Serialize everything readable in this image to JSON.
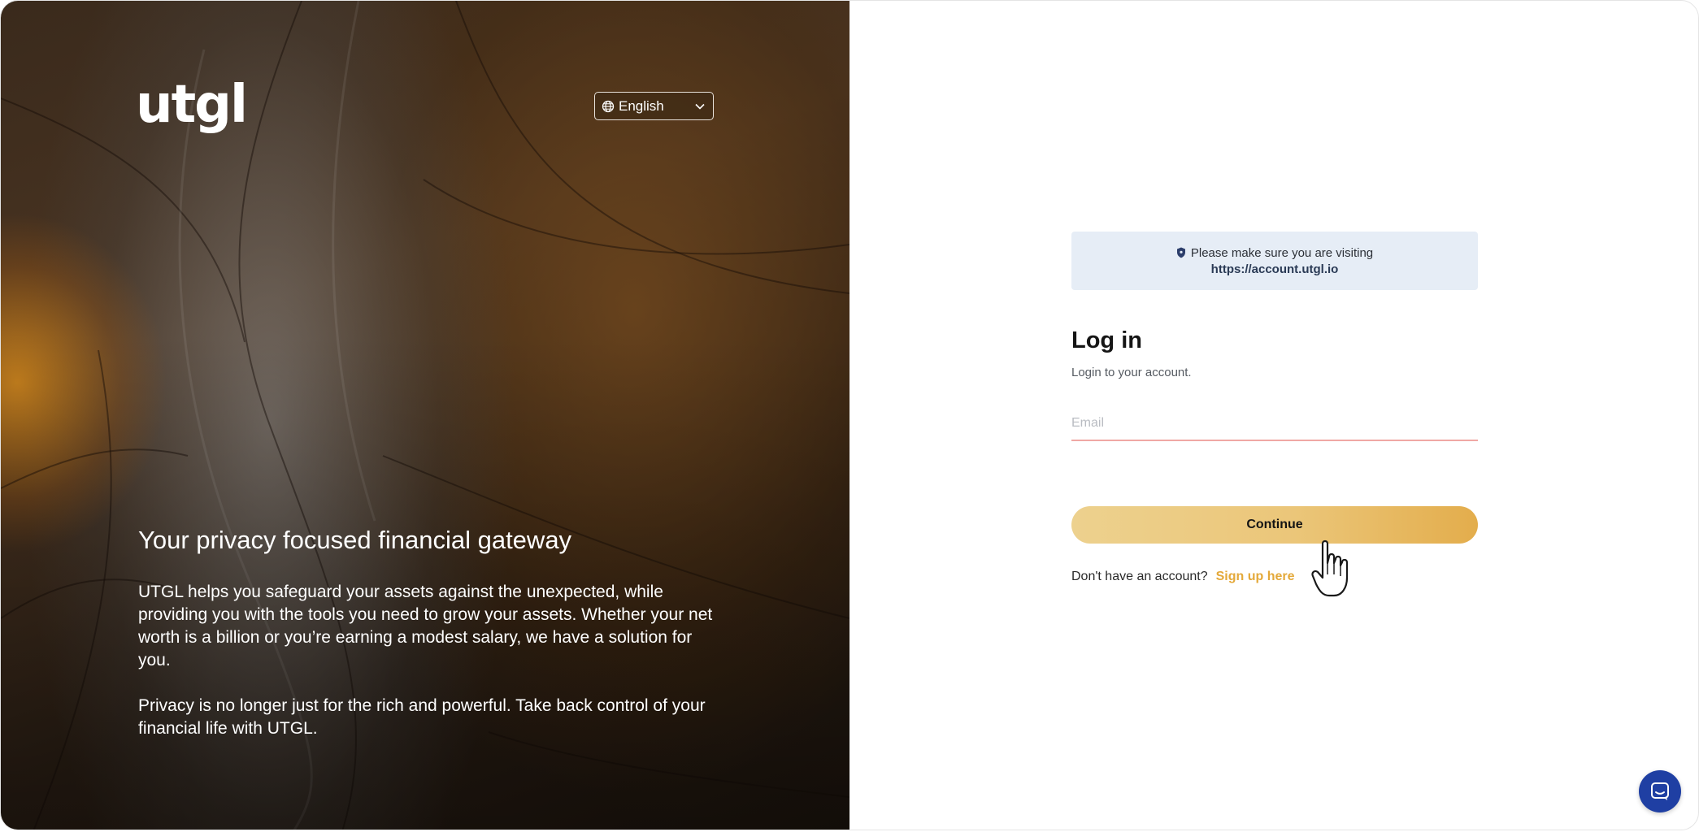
{
  "brand": {
    "logo_text": "utgl"
  },
  "language": {
    "selected": "English",
    "icon": "globe-icon"
  },
  "hero": {
    "title": "Your privacy focused financial gateway",
    "paragraphs": [
      "UTGL helps you safeguard your assets against the unexpected, while providing you with the tools you need to grow your assets. Whether your net worth is a billion or you’re earning a modest salary, we have a solution for you.",
      "Privacy is no longer just for the rich and powerful. Take back control of your financial life with UTGL."
    ]
  },
  "notice": {
    "text": "Please make sure you are visiting",
    "url": "https://account.utgl.io",
    "icon": "shield-icon"
  },
  "login": {
    "title": "Log in",
    "subtitle": "Login to your account.",
    "email_placeholder": "Email",
    "email_value": "",
    "continue_label": "Continue",
    "signup_prompt": "Don't have an account?",
    "signup_link": "Sign up here"
  },
  "colors": {
    "accent_gold": "#e8b95a",
    "link_gold": "#e4a93a",
    "notice_bg": "#e6edf6",
    "input_error_underline": "#f0a8a4",
    "chat_blue": "#1f3fa3"
  },
  "chat": {
    "icon": "chat-icon"
  }
}
